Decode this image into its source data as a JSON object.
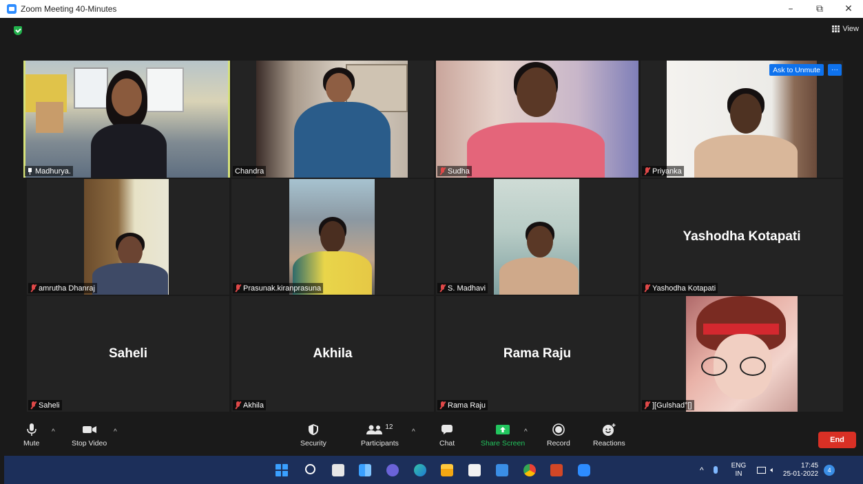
{
  "window": {
    "title": "Zoom Meeting 40-Minutes",
    "minimize": "–",
    "restore": "⧉",
    "close": "✕"
  },
  "topbar": {
    "view_label": "View"
  },
  "participants": [
    {
      "name": "Madhurya.",
      "video": true,
      "muted": false,
      "pinned": true
    },
    {
      "name": "Chandra",
      "video": true,
      "muted": false
    },
    {
      "name": "Sudha",
      "video": true,
      "muted": true
    },
    {
      "name": "Priyanka",
      "video": true,
      "muted": true
    },
    {
      "name": "amrutha Dhanraj",
      "video": true,
      "muted": true
    },
    {
      "name": "Prasunak.kiranprasuna",
      "video": true,
      "muted": true
    },
    {
      "name": "S. Madhavi",
      "video": true,
      "muted": true
    },
    {
      "name": "Yashodha Kotapati",
      "video": false,
      "muted": true
    },
    {
      "name": "Saheli",
      "video": false,
      "muted": true
    },
    {
      "name": "Akhila",
      "video": false,
      "muted": true
    },
    {
      "name": "Rama Raju",
      "video": false,
      "muted": true
    },
    {
      "name": "][Gulshad°[]",
      "video": true,
      "muted": true
    }
  ],
  "priyanka_tile": {
    "ask_unmute": "Ask to Unmute",
    "more": "···"
  },
  "toolbar": {
    "mute": "Mute",
    "stop_video": "Stop Video",
    "security": "Security",
    "participants": "Participants",
    "participants_count": "12",
    "chat": "Chat",
    "share_screen": "Share Screen",
    "record": "Record",
    "reactions": "Reactions",
    "end": "End",
    "caret": "^"
  },
  "tray": {
    "lang_top": "ENG",
    "lang_bottom": "IN",
    "time": "17:45",
    "date": "25-01-2022",
    "notifications": "4",
    "chevron": "^"
  },
  "colors": {
    "accent": "#0e72ed",
    "end": "#d93025",
    "share": "#22c55e",
    "active_speaker": "#d6e27a"
  }
}
